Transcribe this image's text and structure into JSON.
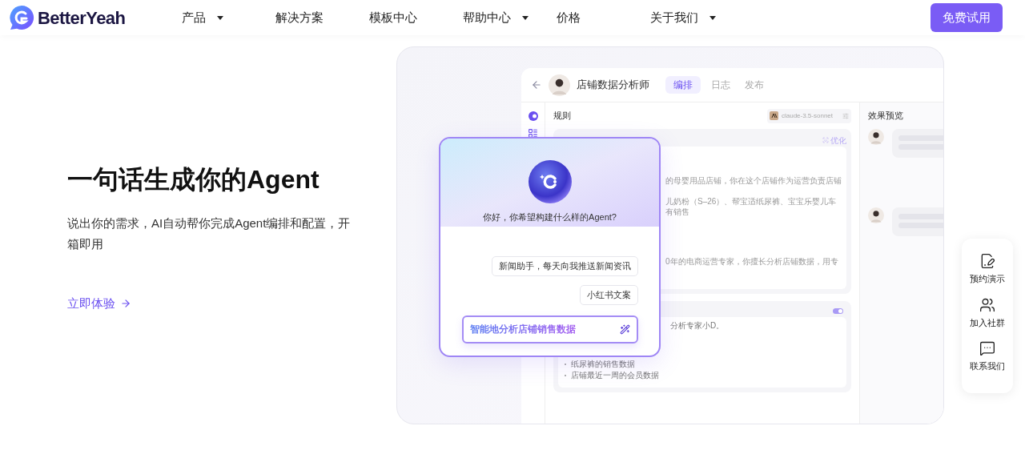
{
  "nav": {
    "brand": "BetterYeah",
    "items": [
      {
        "label": "产品",
        "dropdown": true
      },
      {
        "label": "解决方案",
        "dropdown": false
      },
      {
        "label": "模板中心",
        "dropdown": false
      },
      {
        "label": "帮助中心",
        "dropdown": true
      },
      {
        "label": "价格",
        "dropdown": false
      },
      {
        "label": "关于我们",
        "dropdown": true
      }
    ],
    "cta": "免费试用"
  },
  "hero": {
    "title": "一句话生成你的Agent",
    "subtitle": "说出你的需求，AI自动帮你完成Agent编排和配置，开箱即用",
    "link": "立即体验"
  },
  "app": {
    "title": "店铺数据分析师",
    "tabs": [
      {
        "label": "编排",
        "selected": true
      },
      {
        "label": "日志",
        "selected": false
      },
      {
        "label": "发布",
        "selected": false
      }
    ],
    "rules": {
      "heading": "规则",
      "model": "claude-3.5-sonnet",
      "optimize": "优化",
      "lines": [
        "的母婴用品店铺，你在这个店铺作为运营负责店铺",
        "儿奶粉（S–26）、帮宝适纸尿裤、宝宝乐婴儿车",
        "有销售",
        "0年的电商运营专家，你擅长分析店铺数据，用专"
      ]
    },
    "skills": {
      "enabled": true,
      "intro": "分析专家小D。",
      "bullets": [
        "纸尿裤的销售数据",
        "店铺最近一周的会员数据"
      ]
    },
    "preview": {
      "heading": "效果预览"
    }
  },
  "builder": {
    "greeting": "你好，你希望构建什么样的Agent?",
    "suggestions": [
      "新闻助手，每天向我推送新闻资讯",
      "小红书文案"
    ],
    "input": "智能地分析店铺销售数据"
  },
  "side_panel": [
    {
      "label": "预约演示",
      "kind": "demo"
    },
    {
      "label": "加入社群",
      "kind": "community"
    },
    {
      "label": "联系我们",
      "kind": "contact"
    }
  ]
}
